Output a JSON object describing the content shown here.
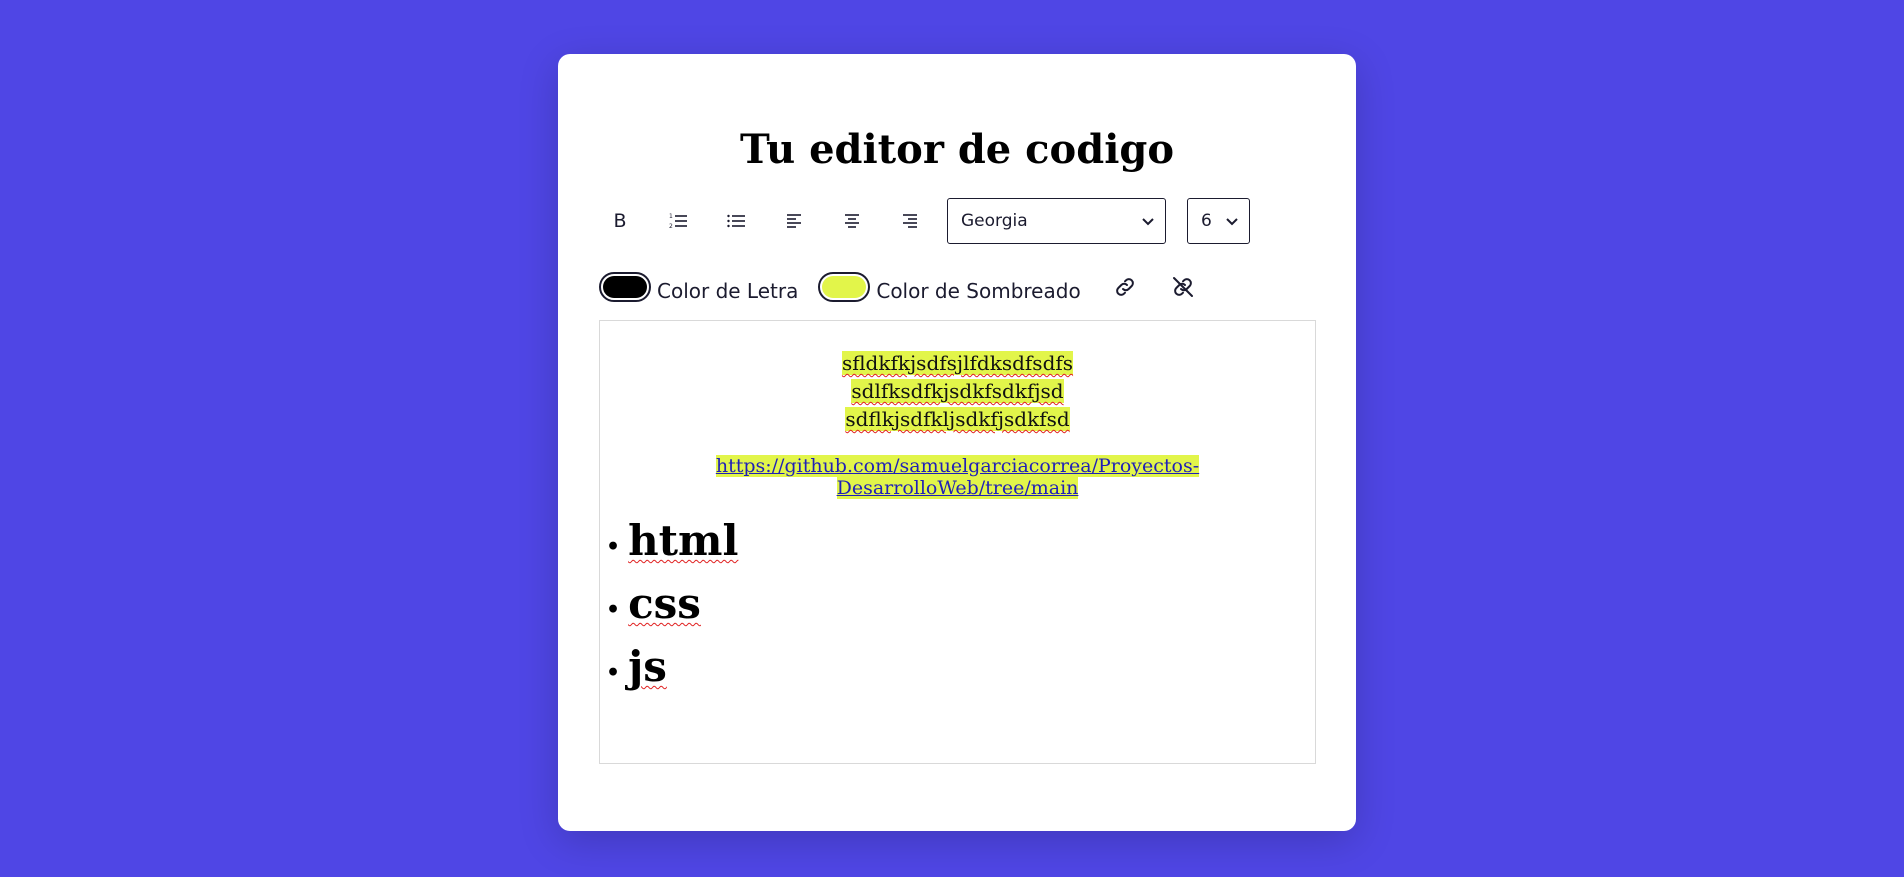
{
  "header": {
    "title": "Tu editor de codigo"
  },
  "toolbar": {
    "bold_label": "B",
    "font_select": {
      "selected": "Georgia"
    },
    "size_select": {
      "selected": "6"
    },
    "text_color": {
      "label": "Color de Letra",
      "value": "#000000"
    },
    "highlight_color": {
      "label": "Color de Sombreado",
      "value": "#e2f54a"
    },
    "icons": {
      "bold": "bold-icon",
      "ordered_list": "ordered-list-icon",
      "unordered_list": "unordered-list-icon",
      "align_left": "align-left-icon",
      "align_center": "align-center-icon",
      "align_right": "align-right-icon",
      "link": "link-icon",
      "unlink": "unlink-icon"
    }
  },
  "editor": {
    "paragraph_lines": [
      "sfldkfkjsdfsjlfdksdfsdfs",
      "sdlfksdfkjsdkfsdkfjsd",
      "sdflkjsdfkljsdkfjsdkfsd"
    ],
    "link_text": "https://github.com/samuelgarciacorrea/Proyectos-DesarrolloWeb/tree/main",
    "list_items": [
      "html",
      "css",
      "js"
    ]
  },
  "colors": {
    "background": "#4f46e5",
    "card": "#ffffff",
    "highlight": "#e2f54a",
    "link": "#1f1fb8"
  }
}
